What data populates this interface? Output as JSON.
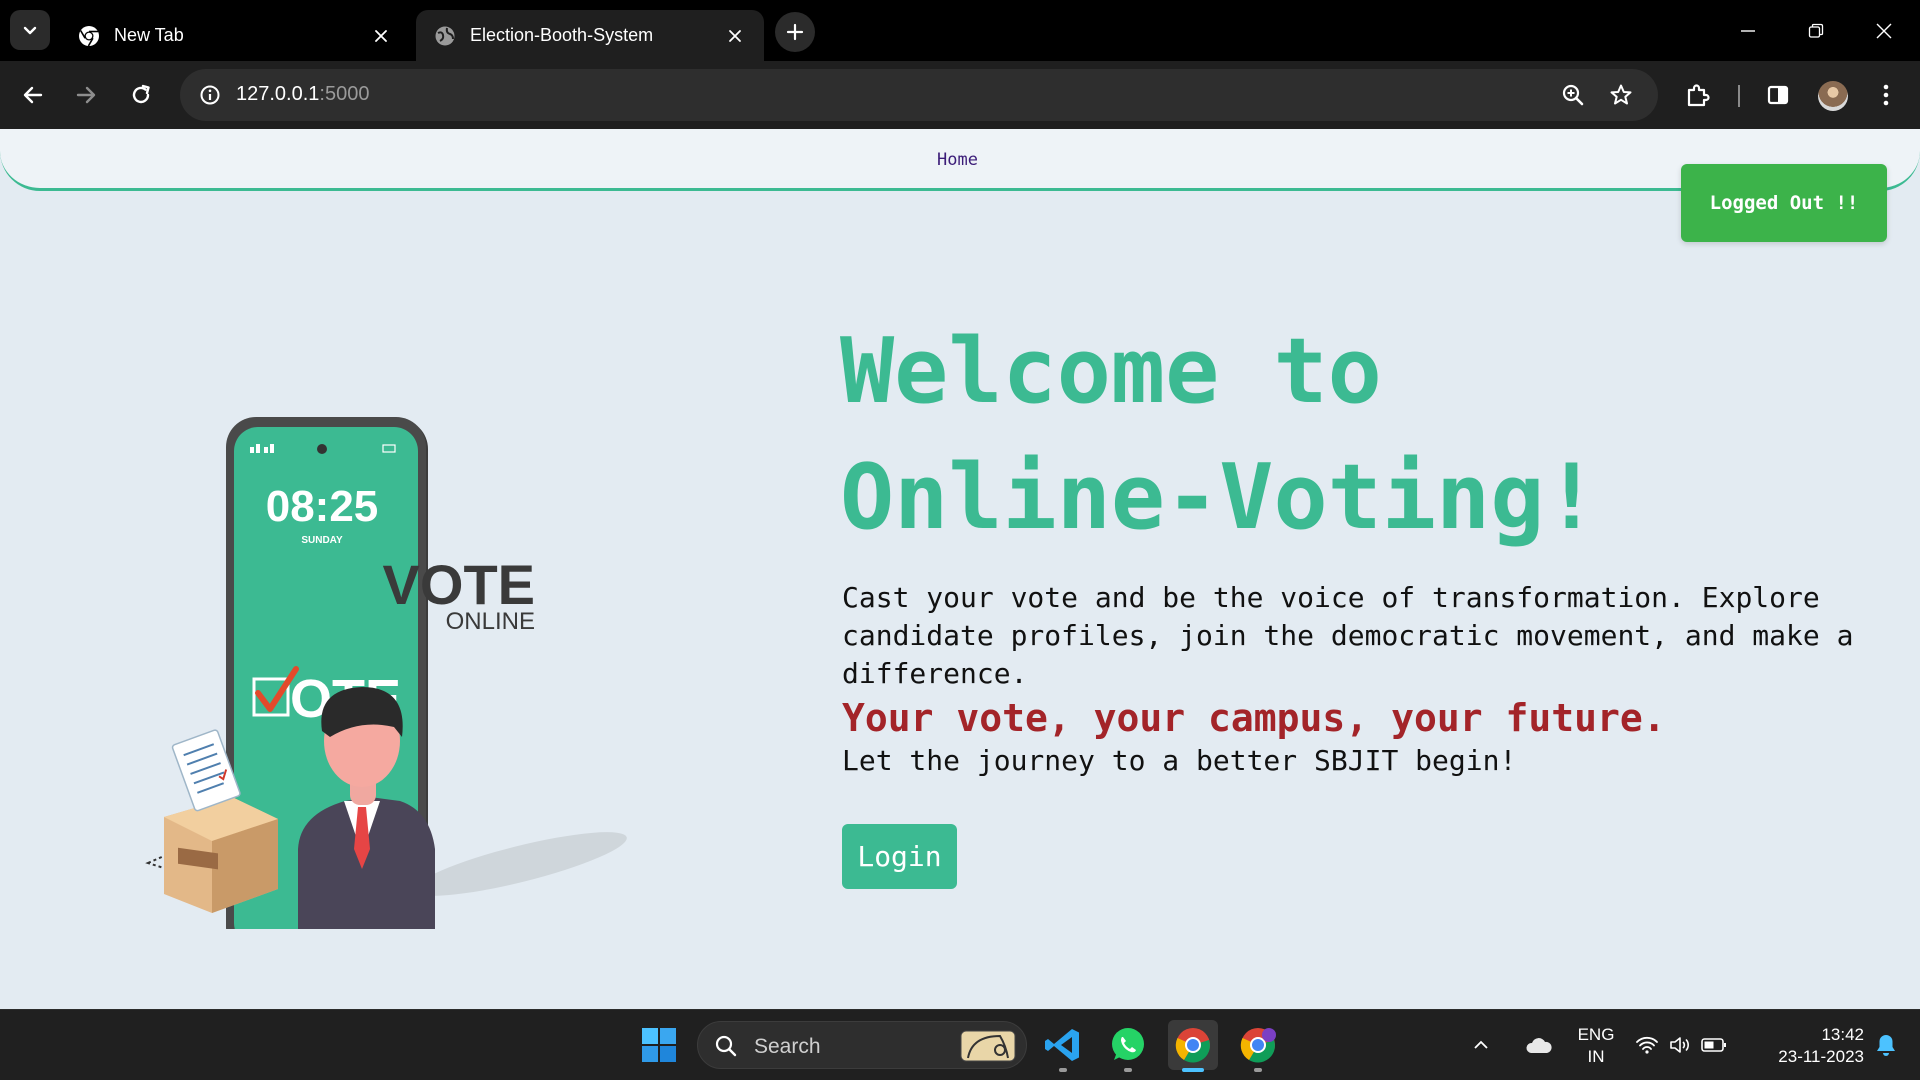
{
  "browser": {
    "tabs": [
      {
        "title": "New Tab",
        "active": false
      },
      {
        "title": "Election-Booth-System",
        "active": true
      }
    ],
    "url": {
      "host": "127.0.0.1",
      "port": ":5000"
    }
  },
  "navbar": {
    "home_label": "Home"
  },
  "toast": {
    "message": "Logged Out !!"
  },
  "illustration": {
    "phone_time": "08:25",
    "phone_day": "SUNDAY",
    "phone_vote": "OTE",
    "logo_main": "VOTE",
    "logo_sub": "ONLINE"
  },
  "hero": {
    "title_line1": "Welcome to",
    "title_line2": "Online-Voting!",
    "description": "Cast your vote and be the voice of transformation. Explore candidate profiles, join the democratic movement, and make a difference.",
    "tagline": "Your vote, your campus, your future.",
    "subline": "Let the journey to a better SBJIT begin!",
    "login_label": "Login"
  },
  "taskbar": {
    "search_placeholder": "Search",
    "lang_line1": "ENG",
    "lang_line2": "IN",
    "time": "13:42",
    "date": "23-11-2023"
  },
  "colors": {
    "accent_green": "#3cba92",
    "toast_green": "#3cb34a",
    "tagline_red": "#a32429",
    "nav_link": "#3b1c78",
    "page_bg": "#e3ebf2"
  },
  "icons": [
    "tab-search-icon",
    "chrome-icon",
    "globe-icon",
    "close-icon",
    "plus-icon",
    "minimize-icon",
    "restore-icon",
    "back-icon",
    "forward-icon",
    "reload-icon",
    "info-icon",
    "zoom-icon",
    "star-icon",
    "extensions-icon",
    "side-panel-icon",
    "menu-icon",
    "windows-start-icon",
    "search-icon",
    "vscode-icon",
    "whatsapp-icon",
    "chevron-up-icon",
    "onedrive-icon",
    "wifi-icon",
    "volume-icon",
    "battery-icon",
    "bell-icon"
  ]
}
